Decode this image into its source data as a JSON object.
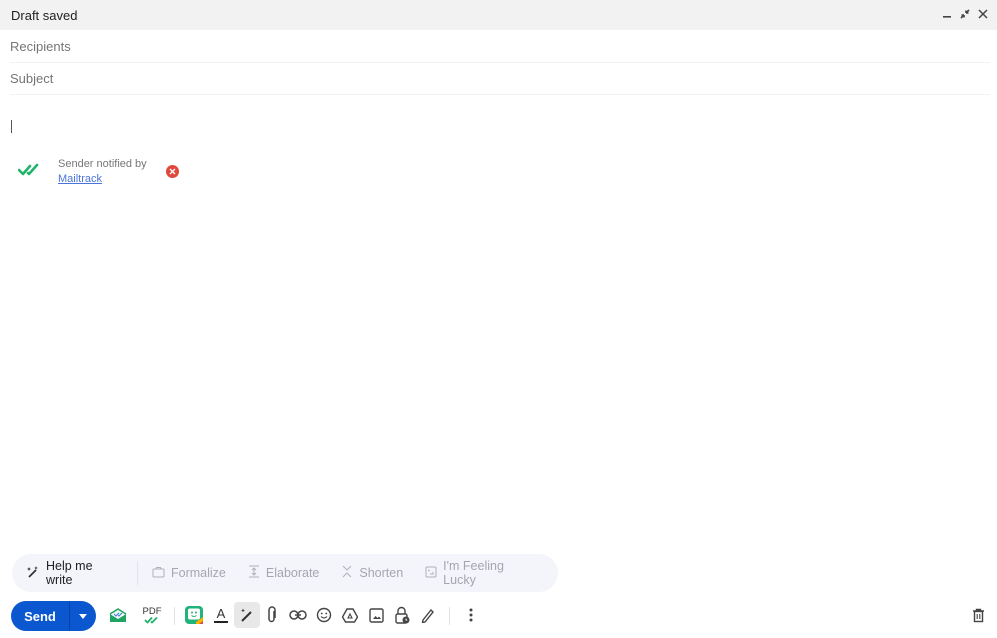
{
  "window": {
    "title": "Draft saved",
    "controls": [
      "minimize-icon",
      "exit-fullscreen-icon",
      "close-icon"
    ]
  },
  "compose": {
    "recipients_placeholder": "Recipients",
    "recipients_value": "",
    "subject_placeholder": "Subject",
    "subject_value": "",
    "body": ""
  },
  "mailtrack": {
    "text": "Sender notified by",
    "link": "Mailtrack",
    "check_color": "#1fb36b",
    "remove_color": "#e0483e"
  },
  "ai_bar": {
    "help": "Help me write",
    "formalize": "Formalize",
    "elaborate": "Elaborate",
    "shorten": "Shorten",
    "lucky": "I'm Feeling Lucky"
  },
  "toolbar": {
    "send_label": "Send",
    "send_color": "#0b57d0",
    "pdf_label": "PDF",
    "text_format_glyph": "A",
    "icons": [
      "mailtrack-icon",
      "pdf-track-icon",
      "bitmoji-icon",
      "formatting-icon",
      "help-me-write-icon",
      "attach-icon",
      "link-icon",
      "emoji-icon",
      "drive-icon",
      "photo-icon",
      "confidential-icon",
      "signature-icon",
      "more-options-icon",
      "discard-icon"
    ]
  }
}
